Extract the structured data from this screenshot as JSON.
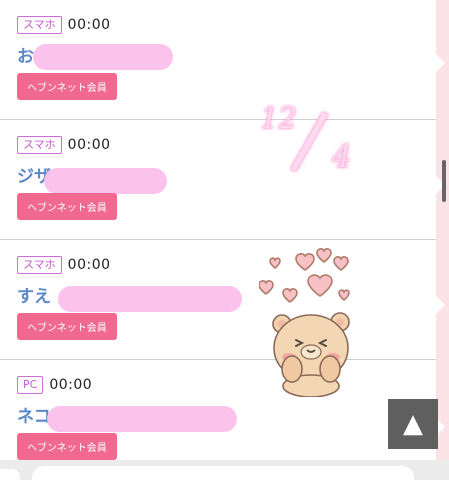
{
  "entries": [
    {
      "device": "スマホ",
      "time": "00:00",
      "name_visible": "お",
      "member_label": "ヘブンネット会員"
    },
    {
      "device": "スマホ",
      "time": "00:00",
      "name_visible": "ジザ",
      "member_label": "ヘブンネット会員"
    },
    {
      "device": "スマホ",
      "time": "00:00",
      "name_visible": "すえ",
      "member_label": "ヘブンネット会員"
    },
    {
      "device": "PC",
      "time": "00:00",
      "name_visible": "ネコ",
      "member_label": "ヘブンネット会員"
    }
  ],
  "date_note": {
    "month": "12",
    "slash": "/",
    "day": "4"
  },
  "scroll_top": {
    "icon": "▲",
    "icon_name": "triangle-up-icon"
  },
  "sticker": {
    "icon_name": "bear-with-hearts-sticker"
  },
  "colors": {
    "badge_border": "#d46adf",
    "name_text": "#5a88c9",
    "member_button": "#f2698f",
    "smear": "#fbc1ea",
    "rail": "#fbe2e6",
    "scroll_top_bg": "#5f5f5f"
  }
}
